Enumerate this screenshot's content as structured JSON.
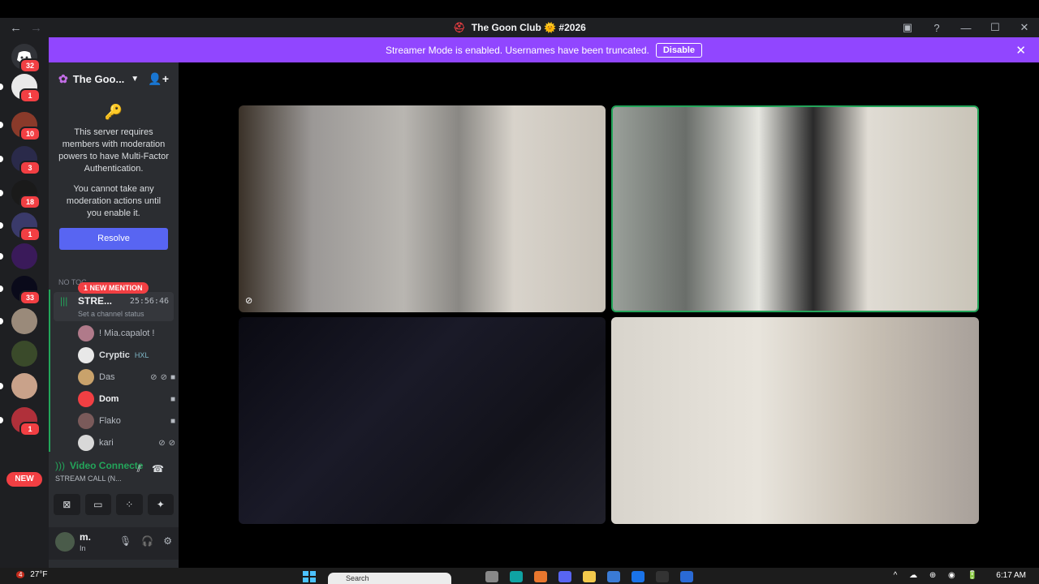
{
  "window": {
    "title": "The Goon Club",
    "title_emoji": "🌞",
    "channel_ref": "#2026"
  },
  "banner": {
    "text": "Streamer Mode is enabled. Usernames have been truncated.",
    "disable_label": "Disable"
  },
  "rail": {
    "home_badge": "32",
    "servers": [
      {
        "badge": "1"
      },
      {
        "badge": "10"
      },
      {
        "badge": "3"
      },
      {
        "badge": "18"
      },
      {
        "badge": "1"
      },
      {
        "badge": ""
      },
      {
        "badge": "33"
      },
      {
        "badge": ""
      },
      {
        "badge": ""
      },
      {
        "badge": ""
      },
      {
        "badge": "1"
      }
    ],
    "new_label": "NEW"
  },
  "sidebar": {
    "server_name": "The Goo...",
    "mfa_text": "This server requires members with moderation powers to have Multi-Factor Authentication.",
    "mfa_sub": "You cannot take any moderation actions until you enable it.",
    "resolve_label": "Resolve",
    "category": "NO TOC...",
    "mention_pill": "1 NEW MENTION",
    "channel": {
      "name": "STRE...",
      "timer": "25:56:46",
      "status_placeholder": "Set a channel status"
    },
    "voice_users": [
      {
        "name": "! Mia.capalot !",
        "color": "#b07a8a"
      },
      {
        "name": "Cryptic",
        "tag": "HXL",
        "color": "#e8e8e8"
      },
      {
        "name": "Das",
        "color": "#c9a26b"
      },
      {
        "name": "Dom",
        "color": "#f23f43"
      },
      {
        "name": "Flako",
        "color": "#7a5a5a"
      },
      {
        "name": "kari",
        "color": "#d8d8d8"
      }
    ],
    "voice_panel": {
      "status": "Video Connecte",
      "sub": "STREAM CALL (N..."
    },
    "user": {
      "name": "m.",
      "status": "In"
    }
  },
  "taskbar": {
    "weather_badge": "4",
    "temperature": "27°F",
    "search_placeholder": "Search",
    "time": "6:17 AM"
  },
  "colors": {
    "accent": "#5865f2",
    "streamer_banner": "#9146ff",
    "speaking": "#23a55a",
    "mention": "#f23f43"
  }
}
